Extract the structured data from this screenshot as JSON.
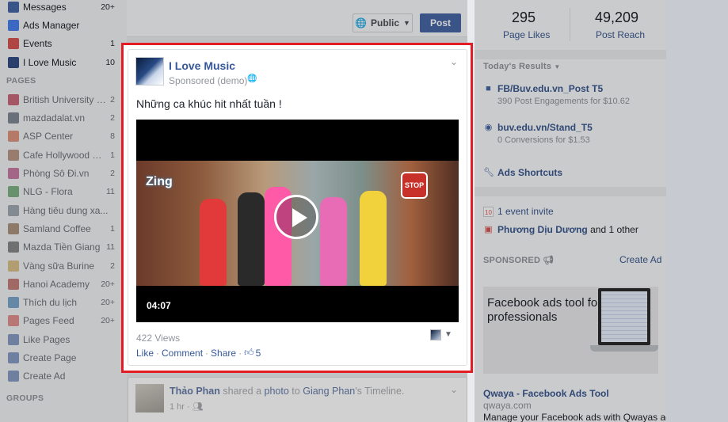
{
  "sidebar": {
    "top_items": [
      {
        "label": "Messages",
        "count": "20+",
        "icon": "messages-icon",
        "color": "#4267b2"
      },
      {
        "label": "Ads Manager",
        "count": "",
        "icon": "ads-manager-icon",
        "color": "#4080ff"
      },
      {
        "label": "Events",
        "count": "1",
        "icon": "calendar-icon",
        "color": "#e9504e"
      },
      {
        "label": "I Love Music",
        "count": "10",
        "icon": "page-icon",
        "color": "#2c4f8c"
      }
    ],
    "pages_header": "PAGES",
    "pages": [
      {
        "label": "British University Vi...",
        "count": "2",
        "color": "#c8102e"
      },
      {
        "label": "mazdadalat.vn",
        "count": "2",
        "color": "#3c4a5e"
      },
      {
        "label": "ASP Center",
        "count": "8",
        "color": "#e2582e"
      },
      {
        "label": "Cafe Hollywood Vi...",
        "count": "1",
        "color": "#a06040"
      },
      {
        "label": "Phòng Sô Đi.vn",
        "count": "2",
        "color": "#c0307a"
      },
      {
        "label": "NLG - Flora",
        "count": "11",
        "color": "#2f8f3a"
      },
      {
        "label": "Hàng tiêu dung xa...",
        "count": "",
        "color": "#6f7d8a"
      },
      {
        "label": "Samland Coffee",
        "count": "1",
        "color": "#8a5a32"
      },
      {
        "label": "Mazda Tiền Giang",
        "count": "11",
        "color": "#4a4a4a"
      },
      {
        "label": "Vàng sữa Burine",
        "count": "2",
        "color": "#d4a23a"
      },
      {
        "label": "Hanoi Academy",
        "count": "20+",
        "color": "#b7392e"
      },
      {
        "label": "Thích du lịch",
        "count": "20+",
        "color": "#2b7bc0"
      },
      {
        "label": "Pages Feed",
        "count": "20+",
        "color": "#e9504e"
      },
      {
        "label": "Like Pages",
        "count": "",
        "color": "#4267b2"
      },
      {
        "label": "Create Page",
        "count": "",
        "color": "#4267b2"
      },
      {
        "label": "Create Ad",
        "count": "",
        "color": "#4267b2"
      }
    ],
    "groups_header": "GROUPS"
  },
  "composer": {
    "privacy_label": "Public",
    "post_label": "Post"
  },
  "post": {
    "page_name": "I Love Music",
    "sponsored_label": "Sponsored (demo)",
    "caption": "Những ca khúc hit nhất tuần !",
    "video_duration": "04:07",
    "watermark": "Zing",
    "stop_sign": "STOP",
    "views": "422 Views",
    "actions": {
      "like": "Like",
      "comment": "Comment",
      "share": "Share"
    },
    "like_count": "5"
  },
  "next_post": {
    "author": "Thảo Phan",
    "shared_text": "shared a",
    "object": "photo",
    "to_text": "to",
    "target": "Giang Phan",
    "suffix": "'s Timeline.",
    "time": "1 hr"
  },
  "right": {
    "page_likes_value": "295",
    "page_likes_label": "Page Likes",
    "post_reach_value": "49,209",
    "post_reach_label": "Post Reach",
    "todays_results": "Today's Results",
    "results": [
      {
        "title": "FB/Buv.edu.vn_Post T5",
        "sub": "390 Post Engagements for $10.62"
      },
      {
        "title": "buv.edu.vn/Stand_T5",
        "sub": "0 Conversions for $1.53"
      }
    ],
    "ads_shortcuts": "Ads Shortcuts",
    "event_invite": "1 event invite",
    "friend_name": "Phương Dịu Dương",
    "friend_suffix": "and 1 other",
    "sponsored_header": "SPONSORED",
    "create_ad": "Create Ad",
    "ad": {
      "headline": "Facebook ads tool for professionals",
      "title": "Qwaya - Facebook Ads Tool",
      "domain": "qwaya.com",
      "description": "Manage your Facebook ads with Qwayas ad"
    }
  }
}
